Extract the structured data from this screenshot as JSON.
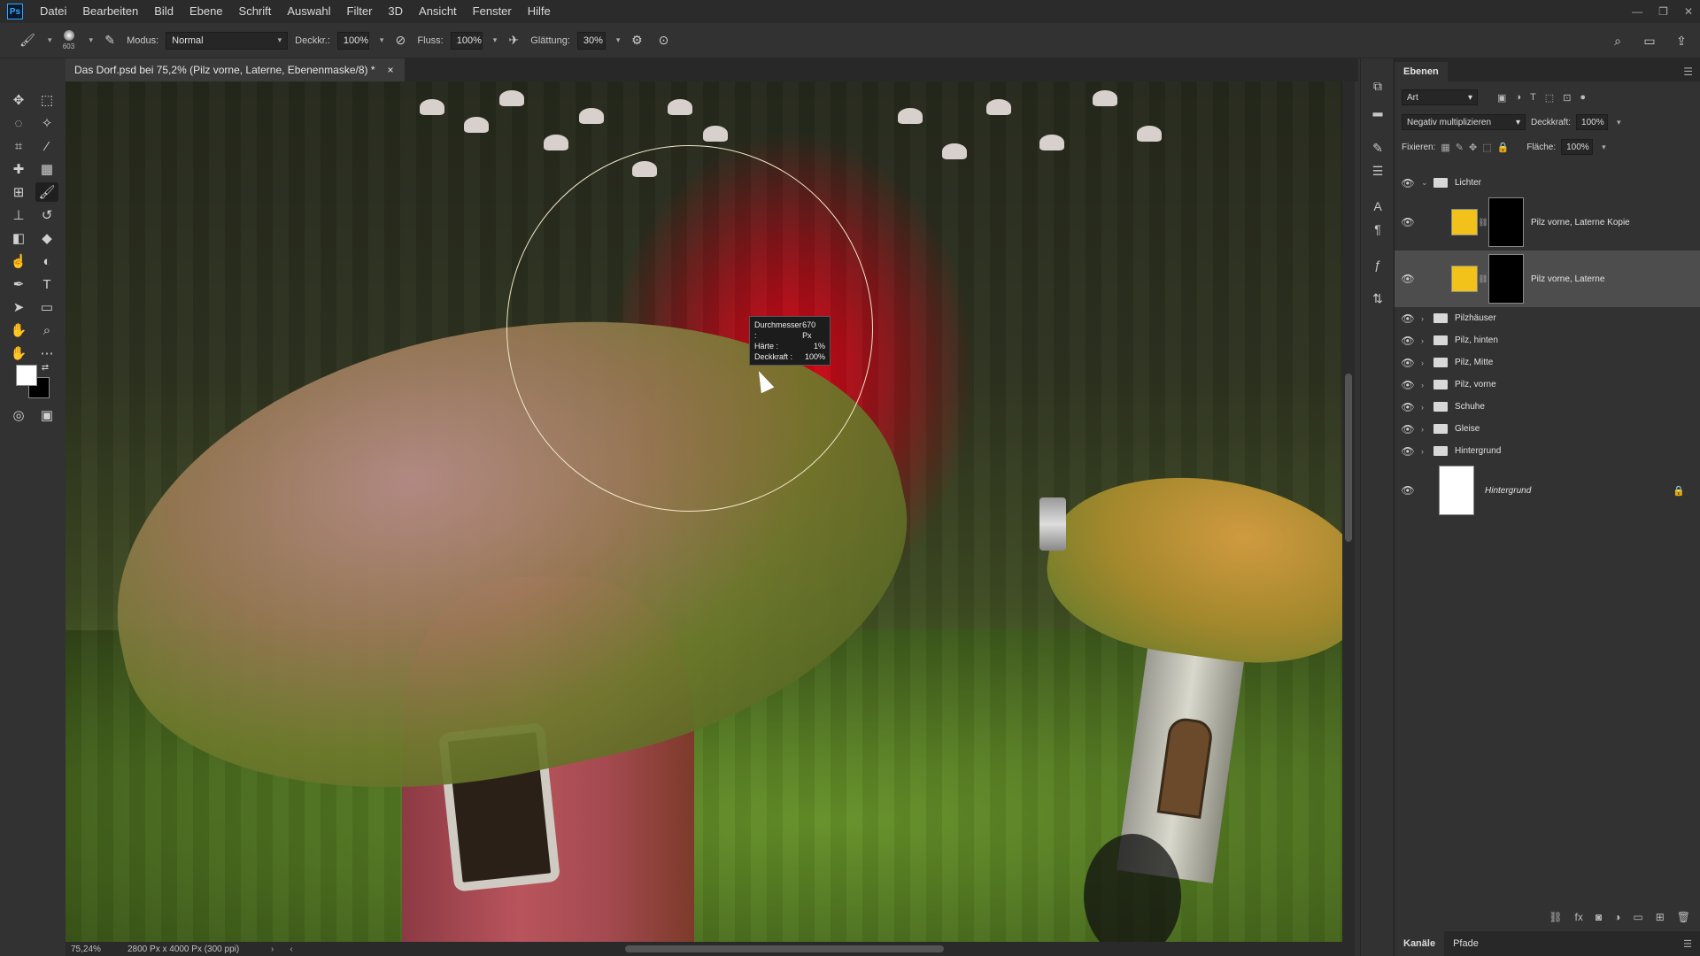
{
  "app": {
    "logo": "Ps"
  },
  "menu": [
    "Datei",
    "Bearbeiten",
    "Bild",
    "Ebene",
    "Schrift",
    "Auswahl",
    "Filter",
    "3D",
    "Ansicht",
    "Fenster",
    "Hilfe"
  ],
  "options": {
    "brush_size": "603",
    "mode_label": "Modus:",
    "mode_value": "Normal",
    "opacity_label": "Deckkr.:",
    "opacity_value": "100%",
    "flow_label": "Fluss:",
    "flow_value": "100%",
    "smoothing_label": "Glättung:",
    "smoothing_value": "30%"
  },
  "document": {
    "tab_title": "Das Dorf.psd bei 75,2% (Pilz vorne, Laterne, Ebenenmaske/8) *",
    "close": "×"
  },
  "brush_hud": {
    "diameter_label": "Durchmesser :",
    "diameter_value": "670 Px",
    "hardness_label": "Härte :",
    "hardness_value": "1%",
    "opacity_label": "Deckkraft :",
    "opacity_value": "100%"
  },
  "status": {
    "zoom": "75,24%",
    "doc_info": "2800 Px x 4000 Px (300 ppi)"
  },
  "layers_panel": {
    "tab": "Ebenen",
    "filter_kind": "Art",
    "blend_mode": "Negativ multiplizieren",
    "opacity_label": "Deckkraft:",
    "opacity_value": "100%",
    "lock_label": "Fixieren:",
    "fill_label": "Fläche:",
    "fill_value": "100%",
    "layers": [
      {
        "name": "Lichter",
        "type": "group"
      },
      {
        "name": "Pilz vorne, Laterne Kopie",
        "type": "layer"
      },
      {
        "name": "Pilz vorne, Laterne",
        "type": "layer",
        "selected": true
      },
      {
        "name": "Pilzhäuser",
        "type": "group"
      },
      {
        "name": "Pilz, hinten",
        "type": "group"
      },
      {
        "name": "Pilz, Mitte",
        "type": "group"
      },
      {
        "name": "Pilz, vorne",
        "type": "group"
      },
      {
        "name": "Schuhe",
        "type": "group"
      },
      {
        "name": "Gleise",
        "type": "group"
      },
      {
        "name": "Hintergrund",
        "type": "group"
      },
      {
        "name": "Hintergrund",
        "type": "background"
      }
    ]
  },
  "bottom_tabs": [
    "Kanäle",
    "Pfade"
  ],
  "colors": {
    "swatch_fg": "#ffffff",
    "swatch_bg": "#000000",
    "layer_thumb": "#f2c21b",
    "brush_red": "#e60014"
  }
}
